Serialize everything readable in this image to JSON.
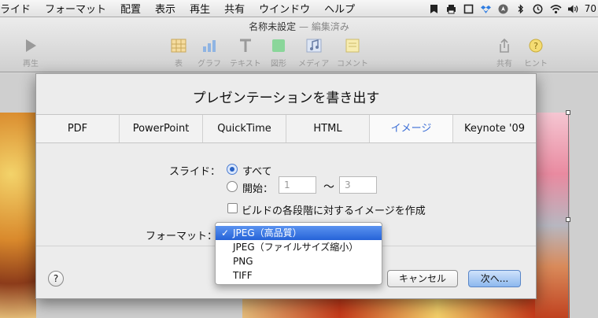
{
  "menubar": {
    "items": [
      "ライド",
      "フォーマット",
      "配置",
      "表示",
      "再生",
      "共有",
      "ウインドウ",
      "ヘルプ"
    ],
    "status_text": "70"
  },
  "window": {
    "title": "名称未設定",
    "edited": " — 編集済み"
  },
  "toolbar": {
    "play": "再生",
    "table": "表",
    "chart": "グラフ",
    "text": "テキスト",
    "shape": "図形",
    "media": "メディア",
    "comment": "コメント",
    "share": "共有",
    "hint": "ヒント"
  },
  "dialog": {
    "title": "プレゼンテーションを書き出す",
    "tabs": [
      "PDF",
      "PowerPoint",
      "QuickTime",
      "HTML",
      "イメージ",
      "Keynote '09"
    ],
    "active_tab": "イメージ",
    "slides_label": "スライド：",
    "option_all": "すべて",
    "option_from": "開始：",
    "from_placeholder": "1",
    "tilde": "〜",
    "to_placeholder": "3",
    "build_checkbox": "ビルドの各段階に対するイメージを作成",
    "format_label": "フォーマット：",
    "help": "?",
    "cancel": "キャンセル",
    "next": "次へ..."
  },
  "format_menu": {
    "check": "✓",
    "options": [
      "JPEG（高品質）",
      "JPEG（ファイルサイズ縮小）",
      "PNG",
      "TIFF"
    ],
    "selected": "JPEG（高品質）"
  },
  "colors": {
    "accent": "#2663d8",
    "active_tab_text": "#3d6fd6"
  }
}
